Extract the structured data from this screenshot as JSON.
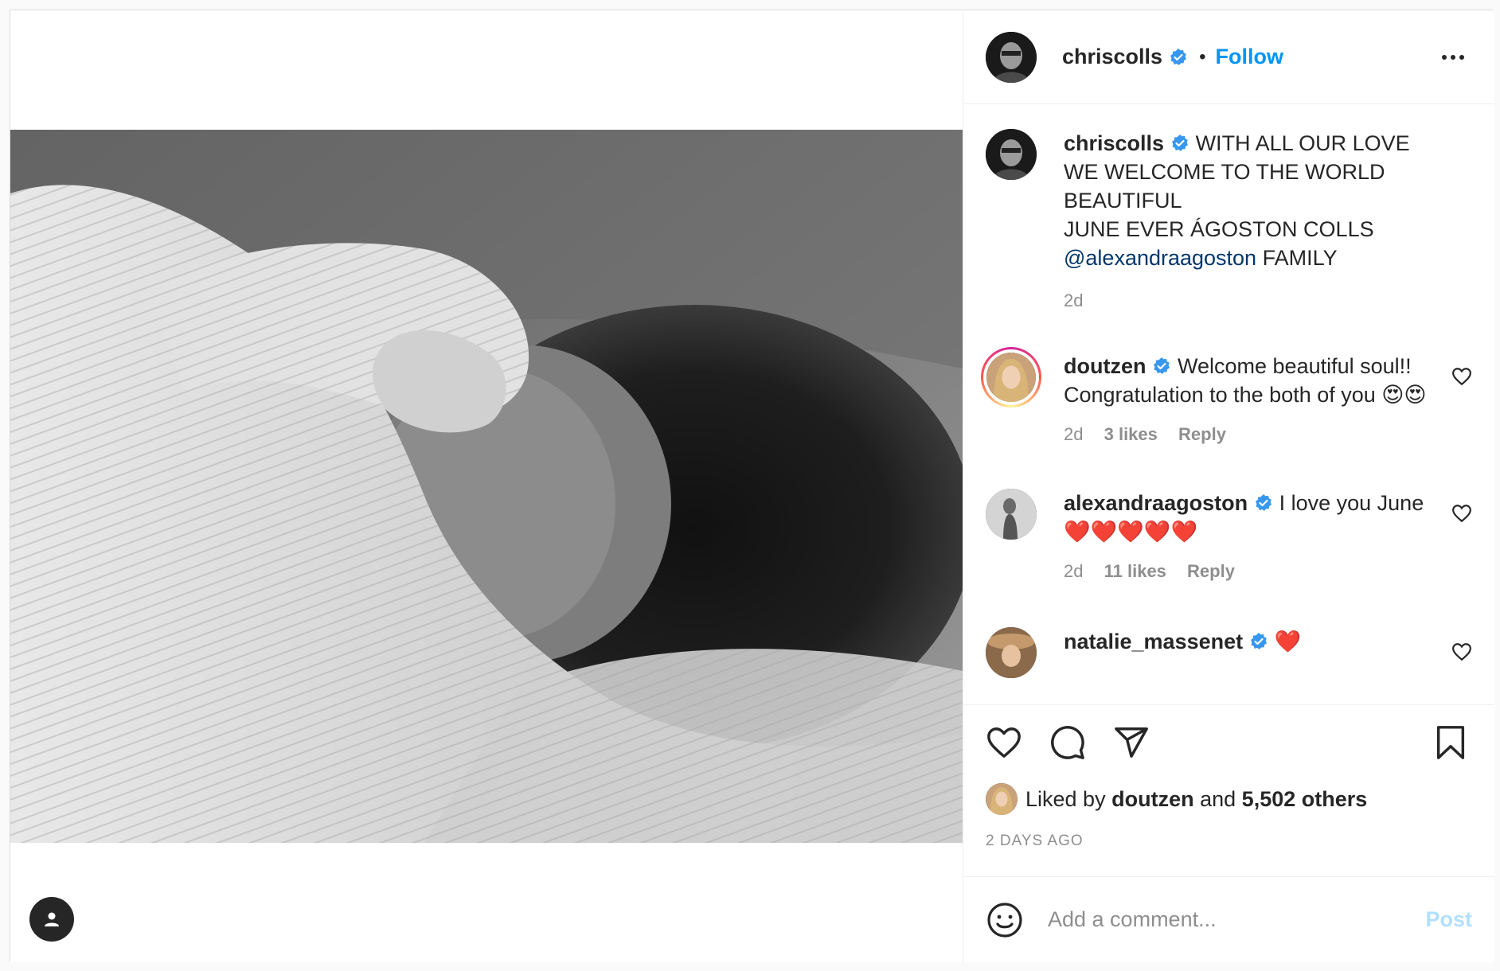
{
  "header": {
    "username": "chriscolls",
    "separator": "•",
    "follow_label": "Follow"
  },
  "caption": {
    "username": "chriscolls",
    "text_before": "WITH ALL OUR LOVE\nWE WELCOME TO THE WORLD\nBEAUTIFUL\nJUNE EVER ÁGOSTON COLLS\n",
    "mention": "@alexandraagoston",
    "text_after": " FAMILY",
    "time": "2d"
  },
  "comments": [
    {
      "username": "doutzen",
      "text": "Welcome beautiful soul!! Congratulation to the both of you 😍😍",
      "time": "2d",
      "likes": "3 likes",
      "reply": "Reply"
    },
    {
      "username": "alexandraagoston",
      "text": "I love you June ❤️❤️❤️❤️❤️",
      "time": "2d",
      "likes": "11 likes",
      "reply": "Reply"
    },
    {
      "username": "natalie_massenet",
      "text": "❤️"
    }
  ],
  "actions": {
    "liked_by_prefix": "Liked by",
    "liked_by_user": "doutzen",
    "liked_by_and": "and",
    "liked_by_others": "5,502 others",
    "posted_ago": "2 DAYS AGO"
  },
  "add_comment": {
    "placeholder": "Add a comment...",
    "post_label": "Post"
  },
  "icons": {
    "like": "heart-icon",
    "comment": "comment-bubble-icon",
    "share": "paper-plane-icon",
    "save": "bookmark-icon",
    "more": "more-options-icon",
    "verified": "verified-badge-icon",
    "emoji": "emoji-icon",
    "user_tag": "user-tag-icon"
  },
  "colors": {
    "accent": "#0095f6",
    "mention": "#00376b",
    "verified": "#3897f0",
    "post_disabled": "#b2dffc",
    "muted": "#8e8e8e"
  }
}
